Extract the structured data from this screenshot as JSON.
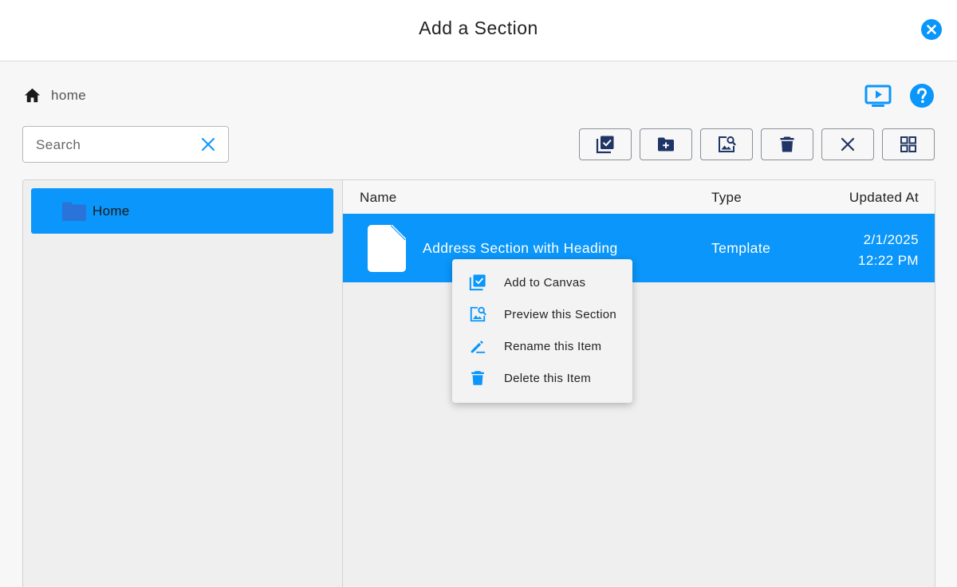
{
  "dialog": {
    "title": "Add a Section"
  },
  "breadcrumb": {
    "label": "home"
  },
  "search": {
    "placeholder": "Search",
    "value": ""
  },
  "tree": {
    "items": [
      {
        "label": "Home",
        "selected": true
      }
    ]
  },
  "table": {
    "columns": {
      "name": "Name",
      "type": "Type",
      "updated": "Updated At"
    },
    "rows": [
      {
        "name": "Address Section with Heading",
        "type": "Template",
        "date": "2/1/2025",
        "time": "12:22 PM",
        "selected": true
      }
    ]
  },
  "context_menu": {
    "items": [
      {
        "label": "Add to Canvas",
        "icon": "add-to-canvas-icon"
      },
      {
        "label": "Preview this Section",
        "icon": "preview-icon"
      },
      {
        "label": "Rename this Item",
        "icon": "rename-icon"
      },
      {
        "label": "Delete this Item",
        "icon": "trash-icon"
      }
    ]
  },
  "toolbar": {
    "buttons": [
      "add-to-canvas-icon",
      "new-folder-icon",
      "preview-icon",
      "trash-icon",
      "close-icon",
      "grid-view-icon"
    ]
  },
  "colors": {
    "accent": "#0a96fa",
    "toolbar_icon": "#1f3566",
    "folder": "#2a73d8"
  }
}
